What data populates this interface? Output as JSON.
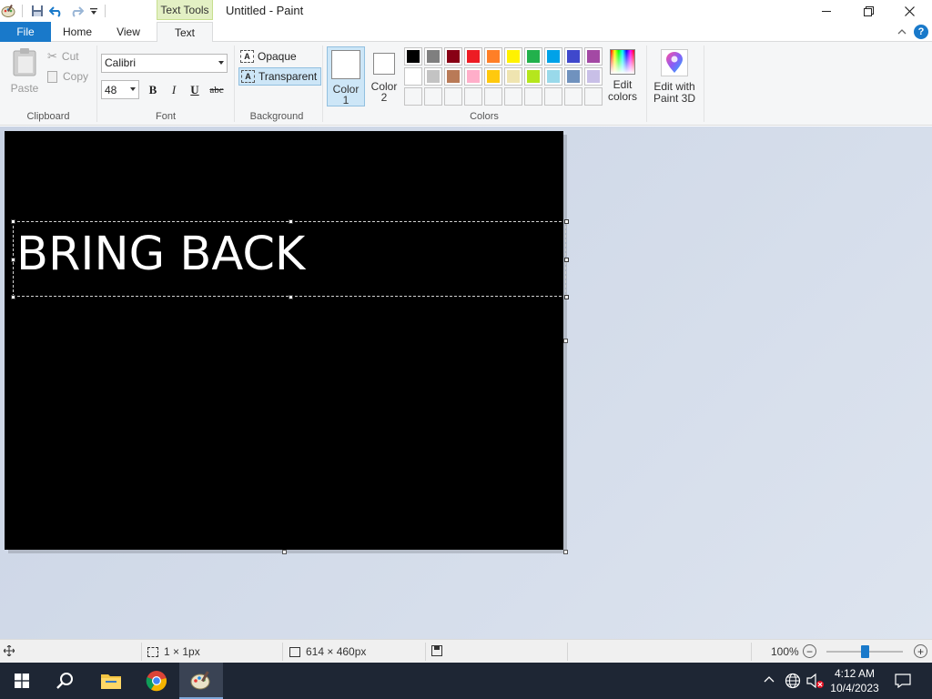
{
  "titlebar": {
    "contextual_tab": "Text Tools",
    "title": "Untitled - Paint"
  },
  "tabs": {
    "file": "File",
    "home": "Home",
    "view": "View",
    "text": "Text"
  },
  "help_label": "?",
  "clipboard": {
    "paste": "Paste",
    "cut": "Cut",
    "copy": "Copy",
    "group_label": "Clipboard"
  },
  "font": {
    "name": "Calibri",
    "size": "48",
    "bold": "B",
    "italic": "I",
    "underline": "U",
    "strikethrough": "abc",
    "group_label": "Font"
  },
  "background": {
    "opaque": "Opaque",
    "transparent": "Transparent",
    "icon_letter": "A",
    "group_label": "Background"
  },
  "colors": {
    "color1_label_line1": "Color",
    "color1_label_line2": "1",
    "color2_label_line1": "Color",
    "color2_label_line2": "2",
    "color1": "#ffffff",
    "color2": "#ffffff",
    "palette": [
      "#000000",
      "#7f7f7f",
      "#880015",
      "#ed1c24",
      "#ff7f27",
      "#fff200",
      "#22b14c",
      "#00a2e8",
      "#3f48cc",
      "#a349a4",
      "#ffffff",
      "#c3c3c3",
      "#b97a57",
      "#ffaec9",
      "#ffc90e",
      "#efe4b0",
      "#b5e61d",
      "#99d9ea",
      "#7092be",
      "#c8bfe7",
      "",
      "",
      "",
      "",
      "",
      "",
      "",
      "",
      "",
      ""
    ],
    "edit_colors_line1": "Edit",
    "edit_colors_line2": "colors",
    "group_label": "Colors"
  },
  "paint3d": {
    "line1": "Edit with",
    "line2": "Paint 3D"
  },
  "canvas": {
    "text": "BRING BACK",
    "background": "#000000",
    "text_color": "#ffffff"
  },
  "statusbar": {
    "selection_size": "1 × 1px",
    "canvas_size": "614 × 460px",
    "zoom": "100%",
    "zoom_minus": "−",
    "zoom_plus": "+"
  },
  "taskbar": {
    "time": "4:12 AM",
    "date": "10/4/2023"
  },
  "accent": "#1979ca"
}
